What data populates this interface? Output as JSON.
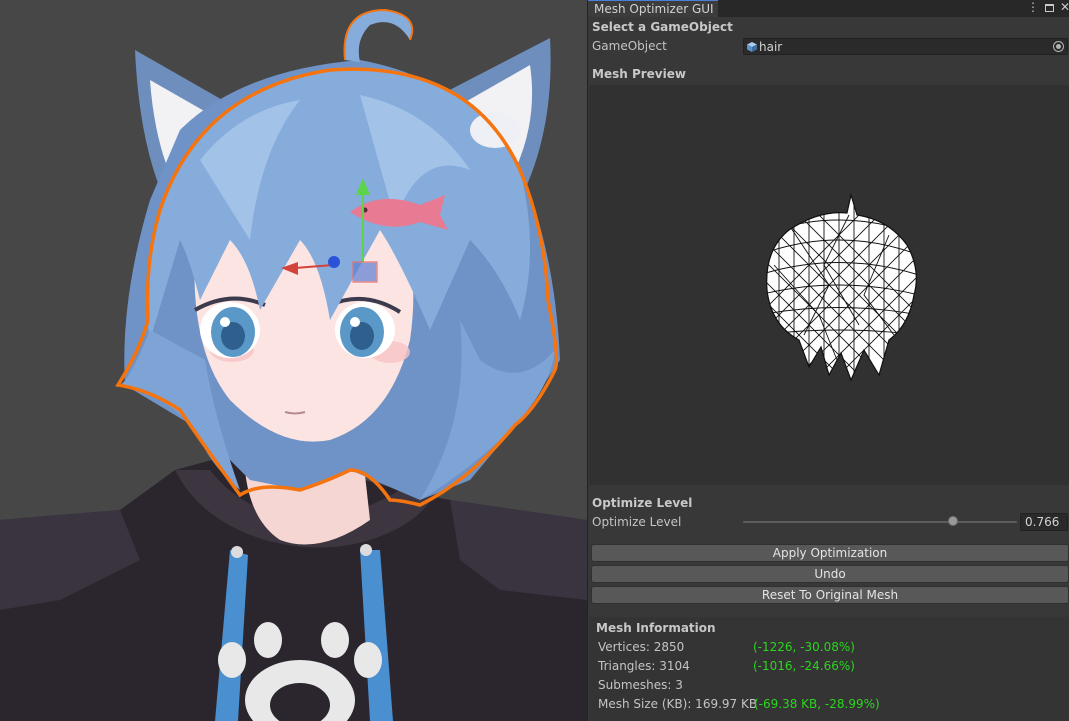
{
  "window": {
    "tab_title": "Mesh Optimizer GUI"
  },
  "select_section": {
    "heading": "Select a GameObject",
    "field_label": "GameObject",
    "field_value": "hair"
  },
  "preview": {
    "heading": "Mesh Preview"
  },
  "optimize": {
    "heading": "Optimize Level",
    "slider_label": "Optimize Level",
    "value": "0.766",
    "slider_fraction": 0.766
  },
  "buttons": {
    "apply": "Apply Optimization",
    "undo": "Undo",
    "reset": "Reset To Original Mesh"
  },
  "info": {
    "heading": "Mesh Information",
    "vertices": "Vertices: 2850",
    "vertices_diff": "(-1226, -30.08%)",
    "triangles": "Triangles: 3104",
    "triangles_diff": "(-1016, -24.66%)",
    "submeshes": "Submeshes: 3",
    "mesh_size": "Mesh Size (KB): 169.97 KB",
    "mesh_size_diff": "(-69.38 KB, -28.99%)"
  },
  "colors": {
    "diff_green": "#2cd51e",
    "selection_outline": "#f5740f",
    "hair_blue": "#7fa6d6"
  }
}
